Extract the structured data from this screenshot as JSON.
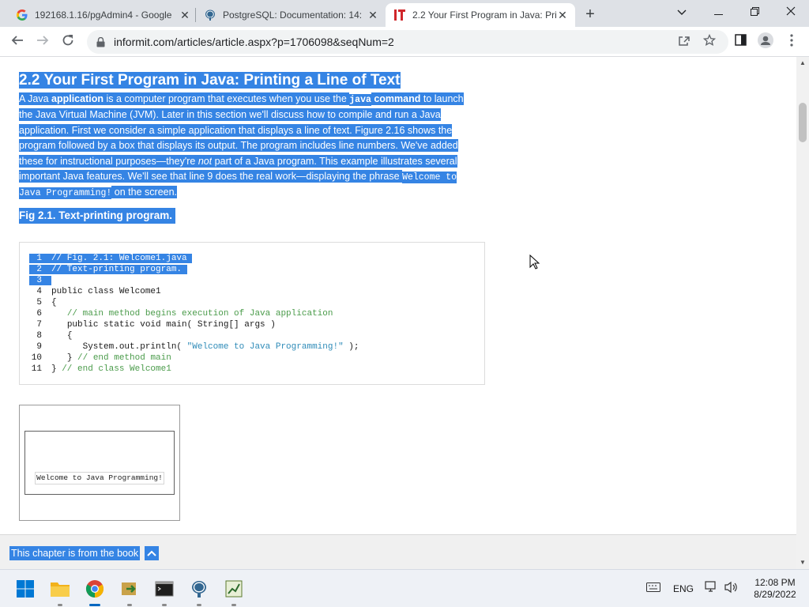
{
  "browser": {
    "tabs": [
      {
        "title": "192168.1.16/pgAdmin4 - Google",
        "icon": "google-g-icon"
      },
      {
        "title": "PostgreSQL: Documentation: 14:",
        "icon": "postgres-elephant-icon"
      },
      {
        "title": "2.2 Your First Program in Java: Pri",
        "icon": "informit-icon",
        "active": true
      }
    ],
    "new_tab_label": "+",
    "url": "informit.com/articles/article.aspx?p=1706098&seqNum=2"
  },
  "article": {
    "heading": "2.2 Your First Program in Java: Printing a Line of Text",
    "paragraph": {
      "p1": "A Java ",
      "b1": "application",
      "p2": " is a computer program that executes when you use the ",
      "code1": "java",
      "b2": " command",
      "p3": " to launch the Java Virtual Machine (JVM). Later in this section we'll discuss how to compile and run a Java application. First we consider a simple application that displays a line of text. Figure 2.16 shows the program followed by a box that displays its output. The program includes line numbers. We've added these for instructional purposes—they're ",
      "em1": "not",
      "p4": " part of a Java program. This example illustrates several important Java features. We'll see that line 9 does the real work—displaying the phrase ",
      "code2": "Welcome to Java Programming!",
      "p5": " on the screen."
    },
    "figure_caption": "Fig 2.1. Text-printing program.",
    "code_lines": [
      {
        "n": "1",
        "text": "// Fig. 2.1: Welcome1.java"
      },
      {
        "n": "2",
        "text": "// Text-printing program."
      },
      {
        "n": "3",
        "text": ""
      },
      {
        "n": "4",
        "text": "public class Welcome1"
      },
      {
        "n": "5",
        "text": "{"
      },
      {
        "n": "6",
        "text": "// main method begins execution of Java application"
      },
      {
        "n": "7",
        "text": "public static void main( String[] args )"
      },
      {
        "n": "8",
        "text": "{"
      },
      {
        "n": "9",
        "pre": "System.out.println( ",
        "str": "\"Welcome to Java Programming!\"",
        "post": " );"
      },
      {
        "n": "10",
        "pre": "}",
        "cmt": " // end method main"
      },
      {
        "n": "11",
        "pre": "}",
        "cmt": " // end class Welcome1"
      }
    ],
    "output_text": "Welcome to Java Programming!",
    "book_bar_label": "This chapter is from the book"
  },
  "taskbar": {
    "apps": [
      "windows-start-icon",
      "file-explorer-icon",
      "chrome-icon",
      "app-arrow-icon",
      "terminal-icon",
      "pgadmin-elephant-icon",
      "chart-app-icon"
    ],
    "language": "ENG",
    "time": "12:08 PM",
    "date": "8/29/2022"
  },
  "colors": {
    "selection": "#3584e4",
    "tab_strip": "#dee1e6",
    "code_comment": "#4a9b4a",
    "code_string": "#2e8bb8",
    "informit_red": "#d0262b"
  }
}
